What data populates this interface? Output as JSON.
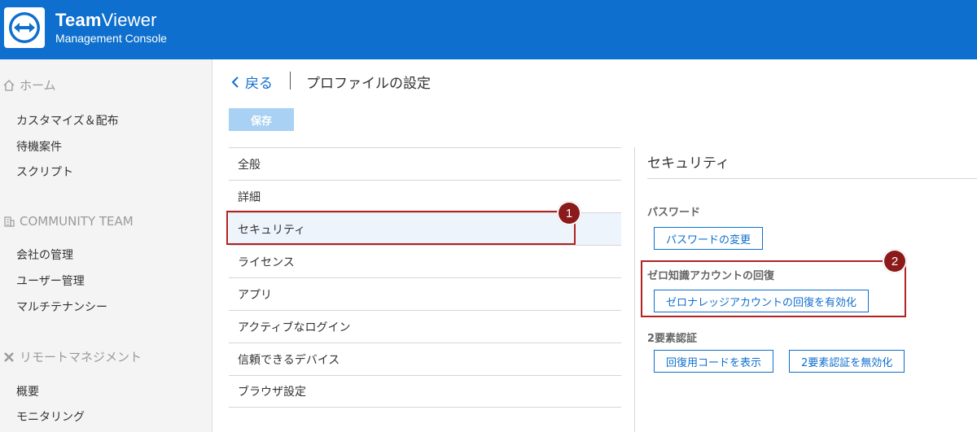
{
  "header": {
    "brand_bold": "Team",
    "brand_light": "Viewer",
    "subtitle": "Management Console",
    "color": "#0e6fce"
  },
  "sidebar": {
    "sections": [
      {
        "icon": "home-icon",
        "label": "ホーム",
        "items": [
          "カスタマイズ＆配布",
          "待機案件",
          "スクリプト"
        ]
      },
      {
        "icon": "building-icon",
        "label": "COMMUNITY TEAM",
        "items": [
          "会社の管理",
          "ユーザー管理",
          "マルチテナンシー"
        ]
      },
      {
        "icon": "remote-management-icon",
        "label": "リモートマネジメント",
        "items": [
          "概要",
          "モニタリング"
        ]
      }
    ]
  },
  "main": {
    "back_label": "戻る",
    "page_title": "プロファイルの設定",
    "save_label": "保存",
    "nav_items": [
      "全般",
      "詳細",
      "セキュリティ",
      "ライセンス",
      "アプリ",
      "アクティブなログイン",
      "信頼できるデバイス",
      "ブラウザ設定"
    ],
    "active_nav": "セキュリティ"
  },
  "security": {
    "title": "セキュリティ",
    "password_label": "パスワード",
    "change_password_button": "パスワードの変更",
    "zero_knowledge_label": "ゼロ知識アカウントの回復",
    "zero_knowledge_button": "ゼロナレッジアカウントの回復を有効化",
    "two_factor_label": "2要素認証",
    "show_recovery_button": "回復用コードを表示",
    "disable_2fa_button": "2要素認証を無効化"
  },
  "annotations": {
    "badge1": "1",
    "badge2": "2",
    "color": "#b22222"
  }
}
